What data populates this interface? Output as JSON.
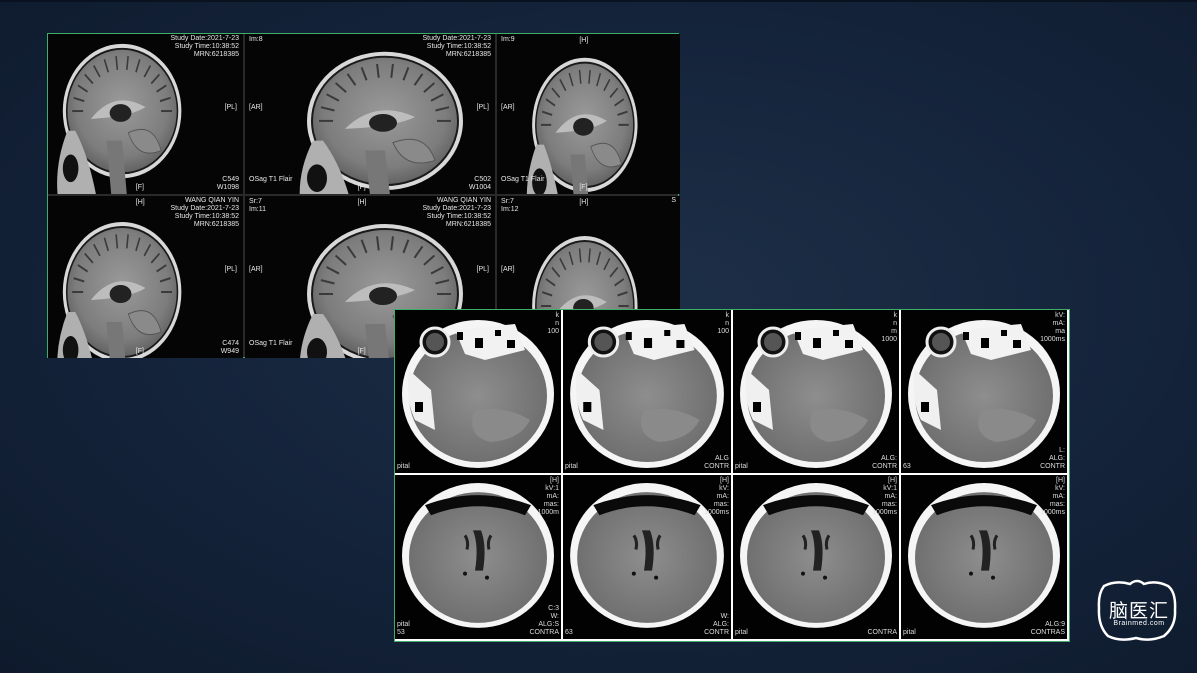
{
  "mri": {
    "series_desc": "OSag T1 Flair",
    "cells": [
      {
        "top_right": [
          "Study Date:2021-7-23",
          "Study Time:10:38:52",
          "MRN:6218385"
        ],
        "mid_right": "[PL]",
        "bottom_right": [
          "C549",
          "W1098"
        ],
        "bottom_center": "[F]"
      },
      {
        "top_left": [
          "Im:8"
        ],
        "mid_left": "[AR]",
        "bottom_left": "OSag T1 Flair",
        "top_right": [
          "Study Date:2021-7-23",
          "Study Time:10:38:52",
          "MRN:6218385"
        ],
        "mid_right": "[PL]",
        "bottom_right": [
          "C502",
          "W1004"
        ],
        "bottom_center": "[F]"
      },
      {
        "top_left": [
          "Im:9"
        ],
        "mid_left": "[AR]",
        "bottom_left": "OSag T1 Flair",
        "top_center": "[H]",
        "bottom_center": "[F]"
      },
      {
        "top_center": "[H]",
        "top_right": [
          "WANG QIAN YIN",
          "Study Date:2021-7-23",
          "Study Time:10:38:52",
          "MRN:6218385"
        ],
        "mid_right": "[PL]",
        "bottom_right": [
          "C474",
          "W949"
        ],
        "bottom_center": "[F]"
      },
      {
        "top_left": [
          "Sr:7",
          "Im:11"
        ],
        "mid_left": "[AR]",
        "bottom_left": "OSag T1 Flair",
        "top_center": "[H]",
        "top_right": [
          "WANG QIAN YIN",
          "Study Date:2021-7-23",
          "Study Time:10:38:52",
          "MRN:6218385"
        ],
        "mid_right": "[PL]",
        "bottom_center": "[F]"
      },
      {
        "top_left": [
          "Sr:7",
          "Im:12"
        ],
        "mid_left": "[AR]",
        "top_center": "[H]",
        "top_right": [
          "S"
        ]
      }
    ]
  },
  "ct": {
    "cells": [
      {
        "right_text": [
          "k",
          "n",
          "100"
        ],
        "bottom_left": [
          "pital"
        ],
        "bottom_right": []
      },
      {
        "right_text": [
          "k",
          "n",
          "100"
        ],
        "bottom_left": [
          "pital"
        ],
        "bottom_right": [
          "ALG",
          "CONTR"
        ]
      },
      {
        "right_text": [
          "k",
          "n",
          "m",
          "1000"
        ],
        "bottom_left": [
          "pital"
        ],
        "bottom_right": [
          "ALG:",
          "CONTR"
        ]
      },
      {
        "right_text": [
          "kV:",
          "mA:",
          "ma",
          "1000ms"
        ],
        "bottom_left": [
          "63"
        ],
        "bottom_right": [
          "L:",
          "ALG:",
          "CONTR"
        ]
      },
      {
        "right_text": [
          "[H]",
          "kV:1",
          "mA:",
          "mas:",
          "1000m"
        ],
        "bottom_left": [
          "pital",
          "53"
        ],
        "bottom_right": [
          "C:3",
          "W:",
          "ALG:S",
          "CONTRA"
        ]
      },
      {
        "right_text": [
          "[H]",
          "kV:",
          "mA:",
          "mas:",
          "1000ms"
        ],
        "bottom_left": [
          "63"
        ],
        "bottom_right": [
          "W:",
          "ALG:",
          "CONTR"
        ]
      },
      {
        "right_text": [
          "[H]",
          "kV:1",
          "mA:",
          "mas:",
          "1000ms"
        ],
        "bottom_left": [
          "pital"
        ],
        "bottom_right": [
          "CONTRA"
        ]
      },
      {
        "right_text": [
          "[H]",
          "kV:",
          "mA:",
          "mas:",
          "1000ms"
        ],
        "bottom_left": [
          "pital"
        ],
        "bottom_right": [
          "ALG:9",
          "CONTRAS"
        ]
      }
    ]
  },
  "logo": {
    "title": "脑医汇",
    "subtitle": "Brainmed.com"
  },
  "colors": {
    "background": "#14233a",
    "panel_border": "#3fae6a"
  }
}
